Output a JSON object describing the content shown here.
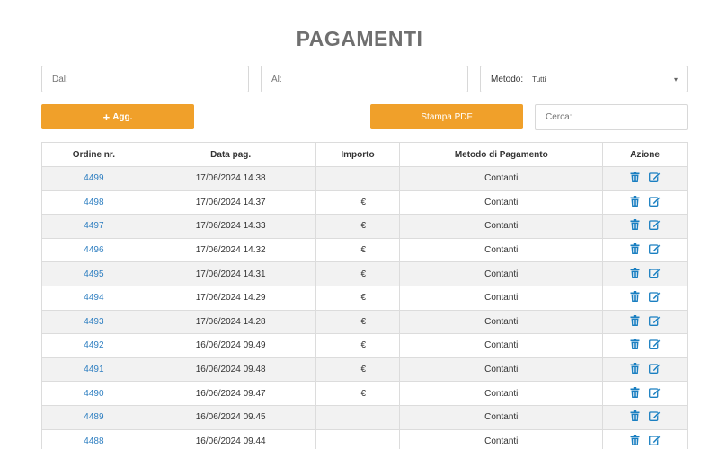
{
  "page": {
    "title": "PAGAMENTI"
  },
  "filters": {
    "dal_label": "Dal:",
    "al_label": "Al:",
    "metodo_label": "Metodo:",
    "metodo_value": "Tutti",
    "cerca_label": "Cerca:"
  },
  "buttons": {
    "add_label": "Agg.",
    "pdf_label": "Stampa PDF"
  },
  "table": {
    "headers": [
      "Ordine nr.",
      "Data pag.",
      "Importo",
      "Metodo di Pagamento",
      "Azione"
    ],
    "rows": [
      {
        "ordine": "4499",
        "data": "17/06/2024 14.38",
        "importo": "",
        "metodo": "Contanti"
      },
      {
        "ordine": "4498",
        "data": "17/06/2024 14.37",
        "importo": "€",
        "metodo": "Contanti"
      },
      {
        "ordine": "4497",
        "data": "17/06/2024 14.33",
        "importo": "€",
        "metodo": "Contanti"
      },
      {
        "ordine": "4496",
        "data": "17/06/2024 14.32",
        "importo": "€",
        "metodo": "Contanti"
      },
      {
        "ordine": "4495",
        "data": "17/06/2024 14.31",
        "importo": "€",
        "metodo": "Contanti"
      },
      {
        "ordine": "4494",
        "data": "17/06/2024 14.29",
        "importo": "€",
        "metodo": "Contanti"
      },
      {
        "ordine": "4493",
        "data": "17/06/2024 14.28",
        "importo": "€",
        "metodo": "Contanti"
      },
      {
        "ordine": "4492",
        "data": "16/06/2024 09.49",
        "importo": "€",
        "metodo": "Contanti"
      },
      {
        "ordine": "4491",
        "data": "16/06/2024 09.48",
        "importo": "€",
        "metodo": "Contanti"
      },
      {
        "ordine": "4490",
        "data": "16/06/2024 09.47",
        "importo": "€",
        "metodo": "Contanti"
      },
      {
        "ordine": "4489",
        "data": "16/06/2024 09.45",
        "importo": "",
        "metodo": "Contanti"
      },
      {
        "ordine": "4488",
        "data": "16/06/2024 09.44",
        "importo": "",
        "metodo": "Contanti"
      }
    ]
  },
  "icons": {
    "delete": "trash-icon",
    "edit": "edit-icon"
  },
  "colors": {
    "accent": "#f0a02a",
    "link": "#2f7fc1",
    "icon": "#1a7fc1",
    "title": "#6f6f6f",
    "row_alt": "#f2f2f2"
  }
}
